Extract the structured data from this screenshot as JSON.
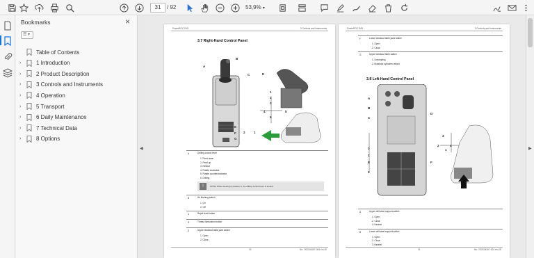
{
  "toolbar": {
    "current_page": "31",
    "page_total": "/ 92",
    "zoom": "53,9%",
    "icons": [
      "save-icon",
      "bookmark-star-icon",
      "upload-icon",
      "print-icon",
      "search-icon",
      "page-up-icon",
      "page-down-icon",
      "cursor-icon",
      "hand-icon",
      "zoom-out-icon",
      "zoom-in-icon",
      "fit-page-icon",
      "scroll-mode-icon",
      "comment-icon",
      "highlight-icon",
      "draw-icon",
      "erase-icon",
      "delete-icon",
      "rotate-icon",
      "sign-icon",
      "mail-icon",
      "more-icon"
    ]
  },
  "sidebar": {
    "title": "Bookmarks",
    "close": "×",
    "options": "☰ ▾",
    "items": [
      {
        "label": "Table of Contents",
        "expandable": false
      },
      {
        "label": "1 Introduction",
        "expandable": true
      },
      {
        "label": "2 Product Description",
        "expandable": true
      },
      {
        "label": "3 Controls and Instruments",
        "expandable": true
      },
      {
        "label": "4 Operation",
        "expandable": true
      },
      {
        "label": "5 Transport",
        "expandable": true
      },
      {
        "label": "6 Daily Maintenance",
        "expandable": true
      },
      {
        "label": "7 Technical Data",
        "expandable": true
      },
      {
        "label": "8 Options",
        "expandable": true
      }
    ]
  },
  "page_left": {
    "header_left": "PowerROC D45",
    "header_right": "3 Controls and Instruments",
    "section_title": "3.7  Right-Hand Control Panel",
    "callouts": [
      "A",
      "B",
      "C",
      "D",
      "E",
      "F",
      "G"
    ],
    "pattern_numbers": [
      "1",
      "2",
      "3",
      "4",
      "5",
      "6",
      "2",
      "1"
    ],
    "table": [
      {
        "key": "A",
        "title": "Drilling control lever",
        "items": [
          "1.  Feed down",
          "2.  Feed up",
          "3.  Neutral",
          "4.  Rotate clockwise",
          "5.  Rotate counterclockwise",
          "6.  Drilling"
        ],
        "note": "NOTE: When feeding to position 6, the drilling control lever is locked."
      },
      {
        "key": "B",
        "title": "Air flushing switch",
        "items": [
          "1.  On",
          "2.  Off"
        ]
      },
      {
        "key": "C",
        "title": "Rapid feed button",
        "items": []
      },
      {
        "key": "D",
        "title": "Thread lubrication button",
        "items": []
      },
      {
        "key": "E",
        "title": "Upper breakout table jaws switch",
        "items": [
          "1.  Open",
          "2.  Close"
        ]
      }
    ],
    "footer_page": "30",
    "footer_doc": "No: 7/02004267-004 en-US"
  },
  "page_right": {
    "header_left": "PowerROC D45",
    "header_right": "3 Controls and Instruments",
    "table_top": [
      {
        "key": "F",
        "title": "Lower breakout table jaws switch",
        "items": [
          "1.  Open",
          "2.  Close"
        ]
      },
      {
        "key": "G",
        "title": "Upper breakout table switch",
        "items": [
          "1.  Uncoupling",
          "2.  Breakout cylinders retract"
        ]
      }
    ],
    "section_title": "3.8  Left-Hand Control Panel",
    "callouts": [
      "A",
      "B",
      "C",
      "D",
      "E",
      "F"
    ],
    "pattern_numbers": [
      "3",
      "2",
      "1",
      "4",
      "3",
      "1",
      "2"
    ],
    "table": [
      {
        "key": "A",
        "title": "Upper drill steel support switch",
        "items": [
          "1.  Open",
          "2.  Close",
          "3.  Neutral"
        ]
      },
      {
        "key": "B",
        "title": "Lower drill steel support switch",
        "items": [
          "1.  Open",
          "2.  Close",
          "3.  Neutral"
        ]
      }
    ],
    "footer_page": "31",
    "footer_doc": "No: 7/02004267-004 en-US"
  }
}
